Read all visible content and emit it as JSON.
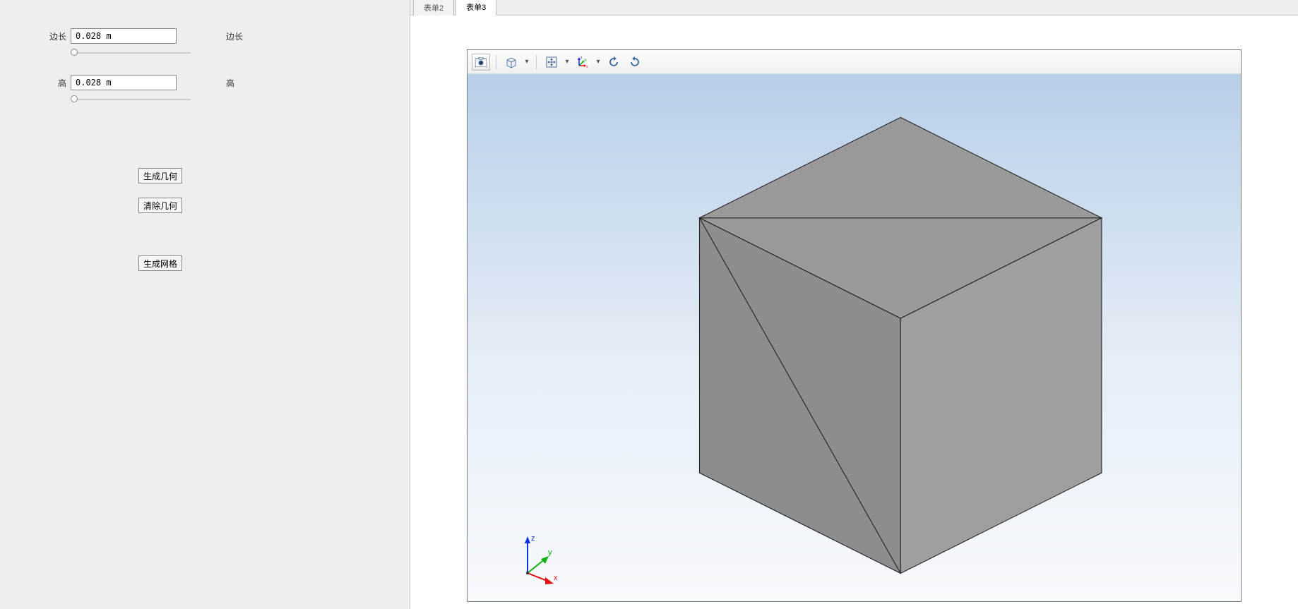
{
  "params": {
    "side": {
      "label_left": "边长",
      "value": "0.028 m",
      "label_right": "边长"
    },
    "height": {
      "label_left": "高",
      "value": "0.028 m",
      "label_right": "高"
    }
  },
  "buttons": {
    "generate_geometry": "生成几何",
    "clear_geometry": "清除几何",
    "generate_mesh": "生成网格"
  },
  "tabs": {
    "tab2": "表单2",
    "tab3": "表单3",
    "active": "tab3"
  },
  "axes": {
    "x": "x",
    "y": "y",
    "z": "z"
  }
}
